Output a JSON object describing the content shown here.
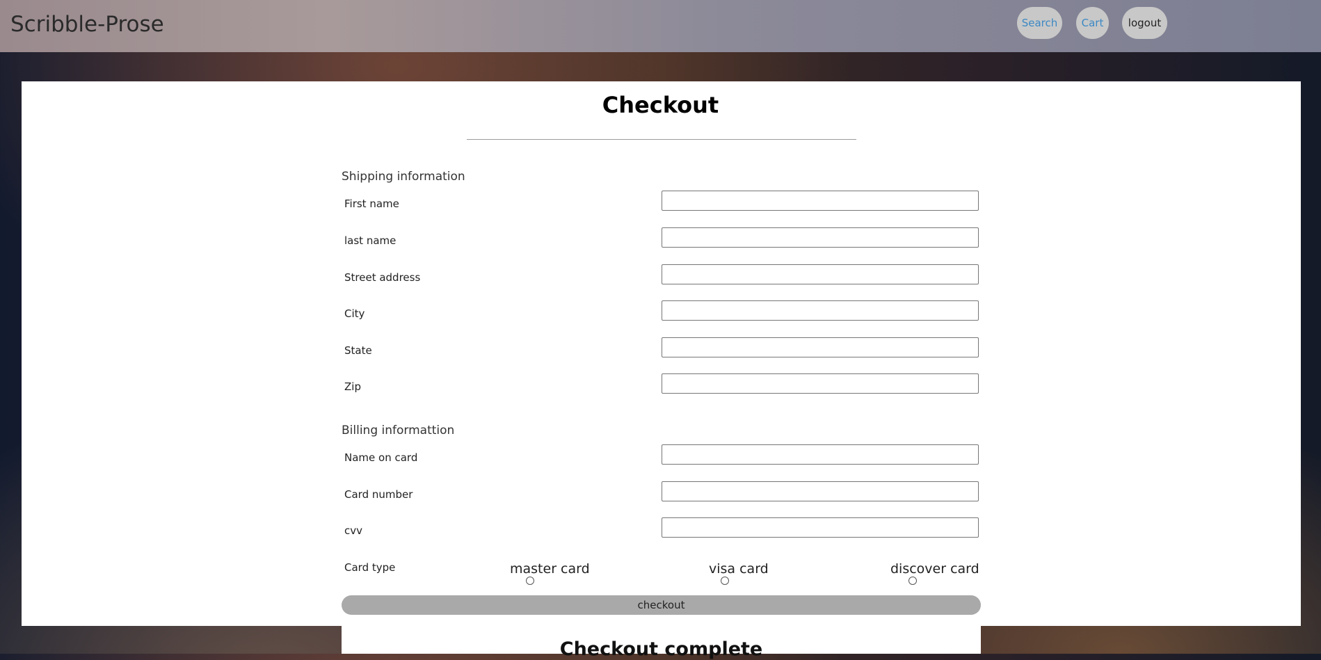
{
  "brand": "Scribble-Prose",
  "nav": {
    "search": "Search",
    "cart": "Cart",
    "logout": "logout"
  },
  "page_title": "Checkout",
  "shipping": {
    "title": "Shipping information",
    "fields": {
      "first_name": "First name",
      "last_name": "last name",
      "street": "Street address",
      "city": "City",
      "state": "State",
      "zip": "Zip"
    }
  },
  "billing": {
    "title": "Billing informattion",
    "fields": {
      "name_on_card": "Name on card",
      "card_number": "Card number",
      "cvv": "cvv"
    },
    "card_type_label": "Card type",
    "card_types": [
      "master card",
      "visa card",
      "discover card"
    ]
  },
  "checkout_button": "checkout",
  "complete_title": "Checkout complete",
  "colors": {
    "link": "#3b88c4",
    "button": "#a9a9a9"
  }
}
